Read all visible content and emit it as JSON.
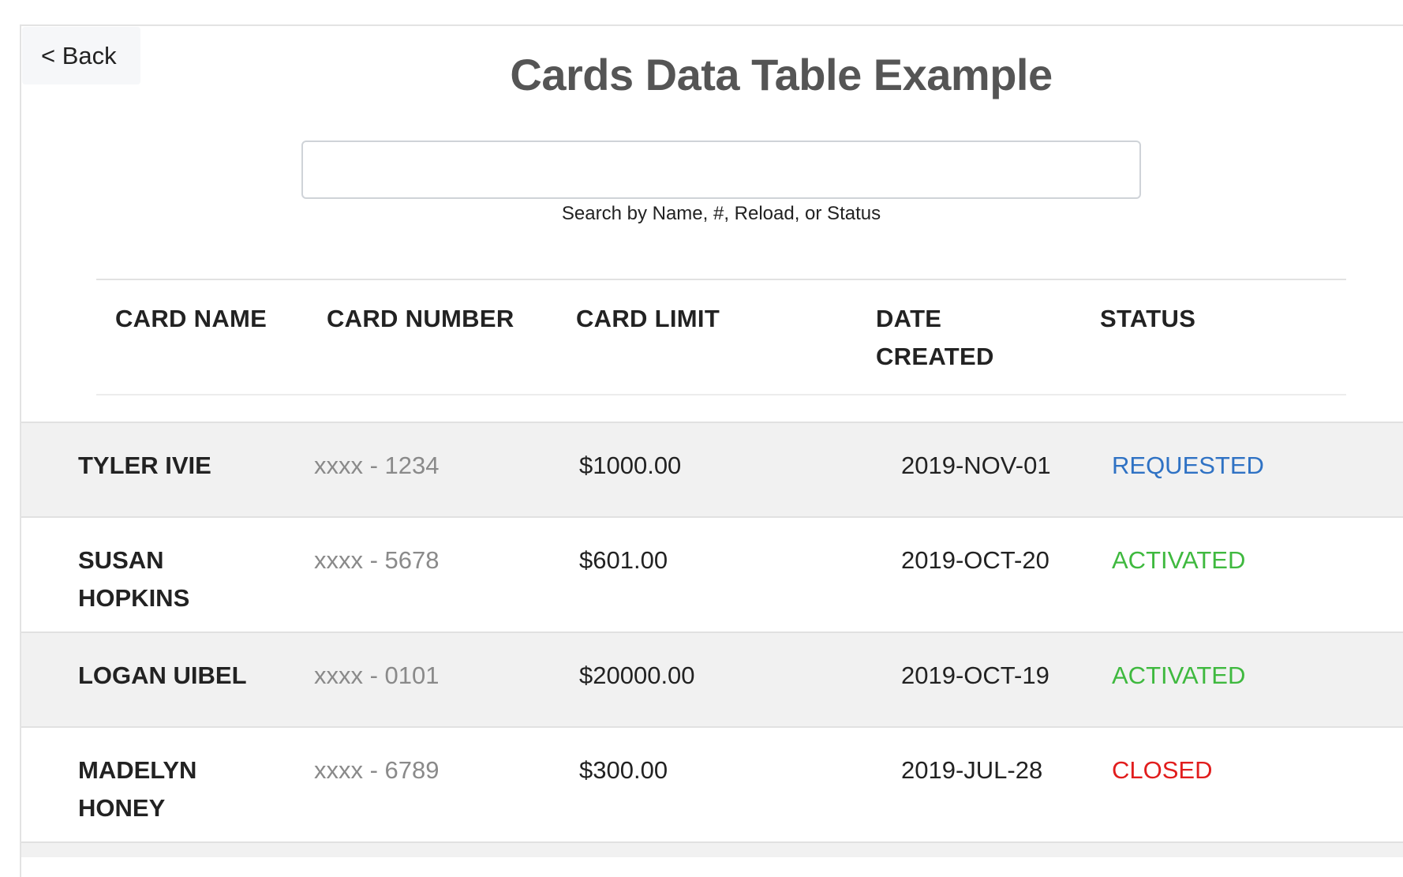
{
  "nav": {
    "back_label": "< Back"
  },
  "page": {
    "title": "Cards Data Table Example"
  },
  "search": {
    "value": "",
    "placeholder": "",
    "hint": "Search by Name, #, Reload, or Status"
  },
  "table": {
    "headers": {
      "name": "CARD NAME",
      "number": "CARD NUMBER",
      "limit": "CARD LIMIT",
      "date_line1": "DATE",
      "date_line2": "CREATED",
      "status": "STATUS"
    },
    "rows": [
      {
        "name": "TYLER IVIE",
        "number": "xxxx - 1234",
        "limit": "$1000.00",
        "date": "2019-NOV-01",
        "status": "REQUESTED"
      },
      {
        "name": "SUSAN HOPKINS",
        "number": "xxxx - 5678",
        "limit": "$601.00",
        "date": "2019-OCT-20",
        "status": "ACTIVATED"
      },
      {
        "name": "LOGAN UIBEL",
        "number": "xxxx - 0101",
        "limit": "$20000.00",
        "date": "2019-OCT-19",
        "status": "ACTIVATED"
      },
      {
        "name": "MADELYN HONEY",
        "number": "xxxx - 6789",
        "limit": "$300.00",
        "date": "2019-JUL-28",
        "status": "CLOSED"
      }
    ]
  },
  "colors": {
    "requested": "#2f72c4",
    "activated": "#3fb93f",
    "closed": "#e11d1d",
    "row_alt": "#f1f1f1"
  }
}
